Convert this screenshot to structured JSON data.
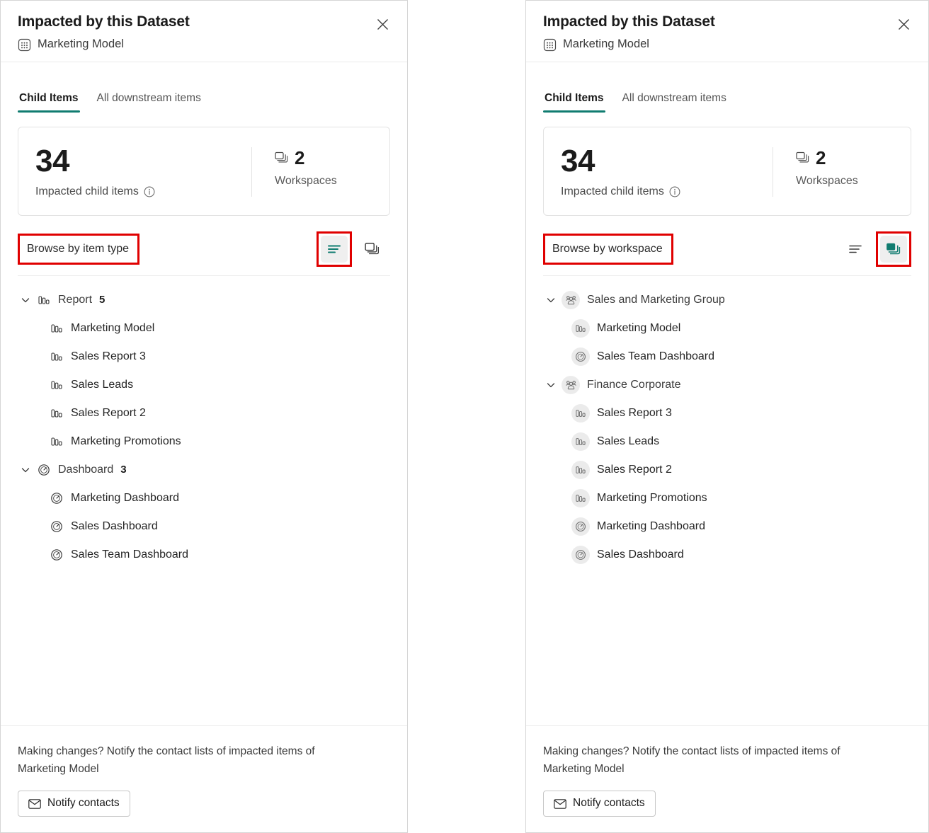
{
  "accent_color": "#107c70",
  "highlight_color": "#e00000",
  "panels": [
    {
      "id": "by-item-type",
      "header": {
        "title": "Impacted by this Dataset",
        "subject": "Marketing Model",
        "subject_icon": "dataset-icon",
        "close_icon": "close-icon"
      },
      "tabs": [
        {
          "label": "Child Items",
          "active": true
        },
        {
          "label": "All downstream items",
          "active": false
        }
      ],
      "summary": {
        "count": "34",
        "count_label": "Impacted child items",
        "info_icon": "info-icon",
        "side_icon": "workspaces-icon",
        "side_count": "2",
        "side_label": "Workspaces"
      },
      "browse": {
        "label": "Browse by item type",
        "label_highlighted": true,
        "toggles": [
          {
            "name": "browse-by-item-type-toggle",
            "icon": "list-lines-icon",
            "selected": true,
            "highlighted": true
          },
          {
            "name": "browse-by-workspace-toggle",
            "icon": "workspaces-stack-icon",
            "selected": false,
            "highlighted": false
          }
        ]
      },
      "tree": [
        {
          "type": "group",
          "label": "Report",
          "count": "5",
          "icon": "report-icon",
          "expanded": true,
          "children": [
            {
              "label": "Marketing Model",
              "icon": "report-icon"
            },
            {
              "label": "Sales Report 3",
              "icon": "report-icon"
            },
            {
              "label": "Sales Leads",
              "icon": "report-icon"
            },
            {
              "label": "Sales Report 2",
              "icon": "report-icon"
            },
            {
              "label": "Marketing Promotions",
              "icon": "report-icon"
            }
          ]
        },
        {
          "type": "group",
          "label": "Dashboard",
          "count": "3",
          "icon": "dashboard-icon",
          "expanded": true,
          "children": [
            {
              "label": "Marketing Dashboard",
              "icon": "dashboard-icon"
            },
            {
              "label": "Sales Dashboard",
              "icon": "dashboard-icon"
            },
            {
              "label": "Sales Team Dashboard",
              "icon": "dashboard-icon"
            }
          ]
        }
      ],
      "footer": {
        "text": "Making changes? Notify the contact lists of impacted items of Marketing Model",
        "button_label": "Notify contacts",
        "button_icon": "mail-icon"
      }
    },
    {
      "id": "by-workspace",
      "header": {
        "title": "Impacted by this Dataset",
        "subject": "Marketing Model",
        "subject_icon": "dataset-icon",
        "close_icon": "close-icon"
      },
      "tabs": [
        {
          "label": "Child Items",
          "active": true
        },
        {
          "label": "All downstream items",
          "active": false
        }
      ],
      "summary": {
        "count": "34",
        "count_label": "Impacted child items",
        "info_icon": "info-icon",
        "side_icon": "workspaces-icon",
        "side_count": "2",
        "side_label": "Workspaces"
      },
      "browse": {
        "label": "Browse by workspace",
        "label_highlighted": true,
        "toggles": [
          {
            "name": "browse-by-item-type-toggle",
            "icon": "list-lines-icon",
            "selected": false,
            "highlighted": false
          },
          {
            "name": "browse-by-workspace-toggle",
            "icon": "workspaces-stack-icon",
            "selected": true,
            "highlighted": true
          }
        ]
      },
      "tree": [
        {
          "type": "workspace",
          "label": "Sales and Marketing Group",
          "icon": "workspace-group-icon",
          "expanded": true,
          "children": [
            {
              "label": "Marketing Model",
              "icon": "report-icon"
            },
            {
              "label": "Sales Team Dashboard",
              "icon": "dashboard-icon"
            }
          ]
        },
        {
          "type": "workspace",
          "label": "Finance Corporate",
          "icon": "workspace-group-icon",
          "expanded": true,
          "children": [
            {
              "label": "Sales Report 3",
              "icon": "report-icon"
            },
            {
              "label": "Sales Leads",
              "icon": "report-icon"
            },
            {
              "label": "Sales Report 2",
              "icon": "report-icon"
            },
            {
              "label": "Marketing Promotions",
              "icon": "report-icon"
            },
            {
              "label": "Marketing Dashboard",
              "icon": "dashboard-icon"
            },
            {
              "label": "Sales Dashboard",
              "icon": "dashboard-icon"
            }
          ]
        }
      ],
      "footer": {
        "text": "Making changes? Notify the contact lists of impacted items of Marketing Model",
        "button_label": "Notify contacts",
        "button_icon": "mail-icon"
      }
    }
  ]
}
